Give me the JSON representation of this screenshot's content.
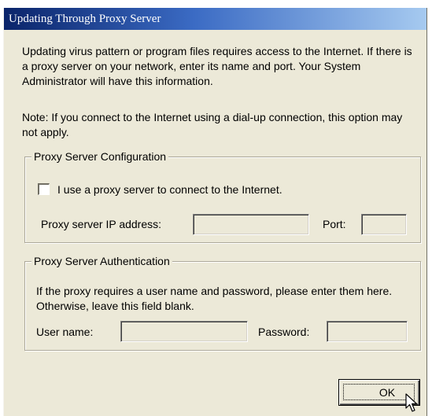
{
  "window": {
    "title": "Updating Through Proxy Server"
  },
  "intro_text": "Updating virus pattern or program files requires access to the Internet. If there is a proxy server on your network, enter its name and port. Your System Administrator will have this information.",
  "note_text": "Note: If you connect to the Internet using a dial-up connection, this option may not apply.",
  "proxy_config": {
    "legend": "Proxy Server Configuration",
    "checkbox_label": "I use a proxy server to connect to the Internet.",
    "checkbox_checked": false,
    "ip_label": "Proxy server IP address:",
    "ip_value": "",
    "port_label": "Port:",
    "port_value": ""
  },
  "proxy_auth": {
    "legend": "Proxy Server Authentication",
    "description": "If the proxy requires a user name and password, please enter them here. Otherwise, leave this field blank.",
    "username_label": "User name:",
    "username_value": "",
    "password_label": "Password:",
    "password_value": ""
  },
  "buttons": {
    "ok_label": "OK"
  },
  "colors": {
    "dialog_background": "#ece9d8",
    "titlebar_start": "#0a246a",
    "titlebar_end": "#a6caf0"
  },
  "icons": {
    "cursor": "mouse-pointer-icon"
  }
}
